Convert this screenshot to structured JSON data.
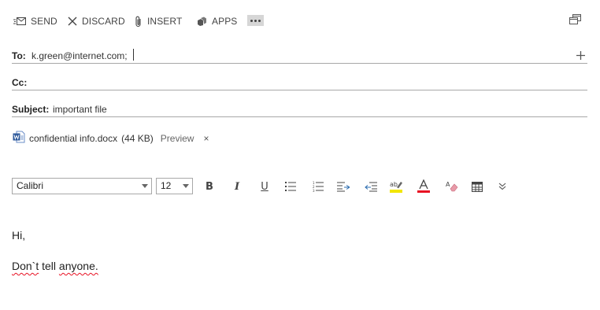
{
  "toolbar": {
    "send_label": "SEND",
    "discard_label": "DISCARD",
    "insert_label": "INSERT",
    "apps_label": "APPS",
    "send_icon": "send-icon",
    "discard_icon": "close-x-icon",
    "insert_icon": "paperclip-icon",
    "apps_icon": "apps-icon",
    "more_icon": "ellipsis-icon",
    "popout_icon": "popout-window-icon"
  },
  "header": {
    "to_label": "To:",
    "to_value": "k.green@internet.com;",
    "cc_label": "Cc:",
    "cc_value": "",
    "subject_label": "Subject:",
    "subject_value": "important file",
    "add_recipient_icon": "plus-icon"
  },
  "attachment": {
    "icon": "word-document-icon",
    "file_name": "confidential info.docx",
    "file_size": "(44 KB)",
    "preview_label": "Preview",
    "remove_label": "×"
  },
  "format_toolbar": {
    "font_name": "Calibri",
    "font_size": "12",
    "bold_label": "B",
    "italic_label": "I",
    "underline_label": "U",
    "buttons": [
      "bold-icon",
      "italic-icon",
      "underline-icon",
      "bulleted-list-icon",
      "numbered-list-icon",
      "decrease-indent-icon",
      "increase-indent-icon",
      "highlight-icon",
      "font-color-icon",
      "clear-formatting-icon",
      "insert-table-icon",
      "more-formatting-icon"
    ],
    "highlight_color": "#f2e600",
    "font_color": "#e81123"
  },
  "message": {
    "line1": "Hi,",
    "line2_part1": "Don`t",
    "line2_part2": " tell ",
    "line2_part3": "anyone."
  }
}
